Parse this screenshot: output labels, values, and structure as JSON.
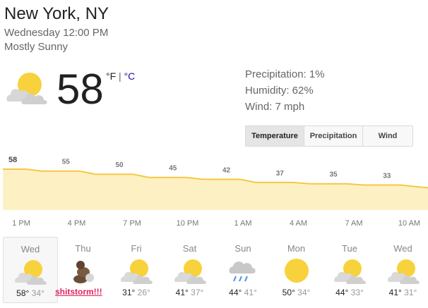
{
  "location": "New York, NY",
  "datetime": "Wednesday 12:00 PM",
  "condition": "Mostly Sunny",
  "current": {
    "temp": "58",
    "unit_f": "°F",
    "unit_sep": " | ",
    "unit_c": "°C",
    "icon": "partly-cloudy-icon"
  },
  "stats": {
    "precipitation": "Precipitation: 1%",
    "humidity": "Humidity: 62%",
    "wind": "Wind: 7 mph"
  },
  "tabs": [
    "Temperature",
    "Precipitation",
    "Wind"
  ],
  "chart_data": {
    "type": "area",
    "x": [
      "1 PM",
      "4 PM",
      "7 PM",
      "10 PM",
      "1 AM",
      "4 AM",
      "7 AM",
      "10 AM"
    ],
    "values": [
      58,
      55,
      50,
      45,
      42,
      37,
      35,
      33
    ],
    "value_labels": [
      "58",
      "55",
      "50",
      "45",
      "42",
      "37",
      "35",
      "33"
    ],
    "colors": {
      "line": "#f4c842",
      "fill": "#fdf1c4"
    }
  },
  "forecast": [
    {
      "day": "Wed",
      "hi": "58°",
      "lo": "34°",
      "icon": "partly-cloudy-icon"
    },
    {
      "day": "Thu",
      "hi": "",
      "lo": "",
      "icon": "poop-icon",
      "label": "shitstorm!!!"
    },
    {
      "day": "Fri",
      "hi": "31°",
      "lo": "26°",
      "icon": "partly-cloudy-icon"
    },
    {
      "day": "Sat",
      "hi": "41°",
      "lo": "37°",
      "icon": "partly-cloudy-icon"
    },
    {
      "day": "Sun",
      "hi": "44°",
      "lo": "41°",
      "icon": "rain-cloud-icon"
    },
    {
      "day": "Mon",
      "hi": "50°",
      "lo": "34°",
      "icon": "sun-icon"
    },
    {
      "day": "Tue",
      "hi": "44°",
      "lo": "33°",
      "icon": "partly-cloudy-icon"
    },
    {
      "day": "Wed",
      "hi": "41°",
      "lo": "31°",
      "icon": "partly-cloudy-icon"
    }
  ]
}
